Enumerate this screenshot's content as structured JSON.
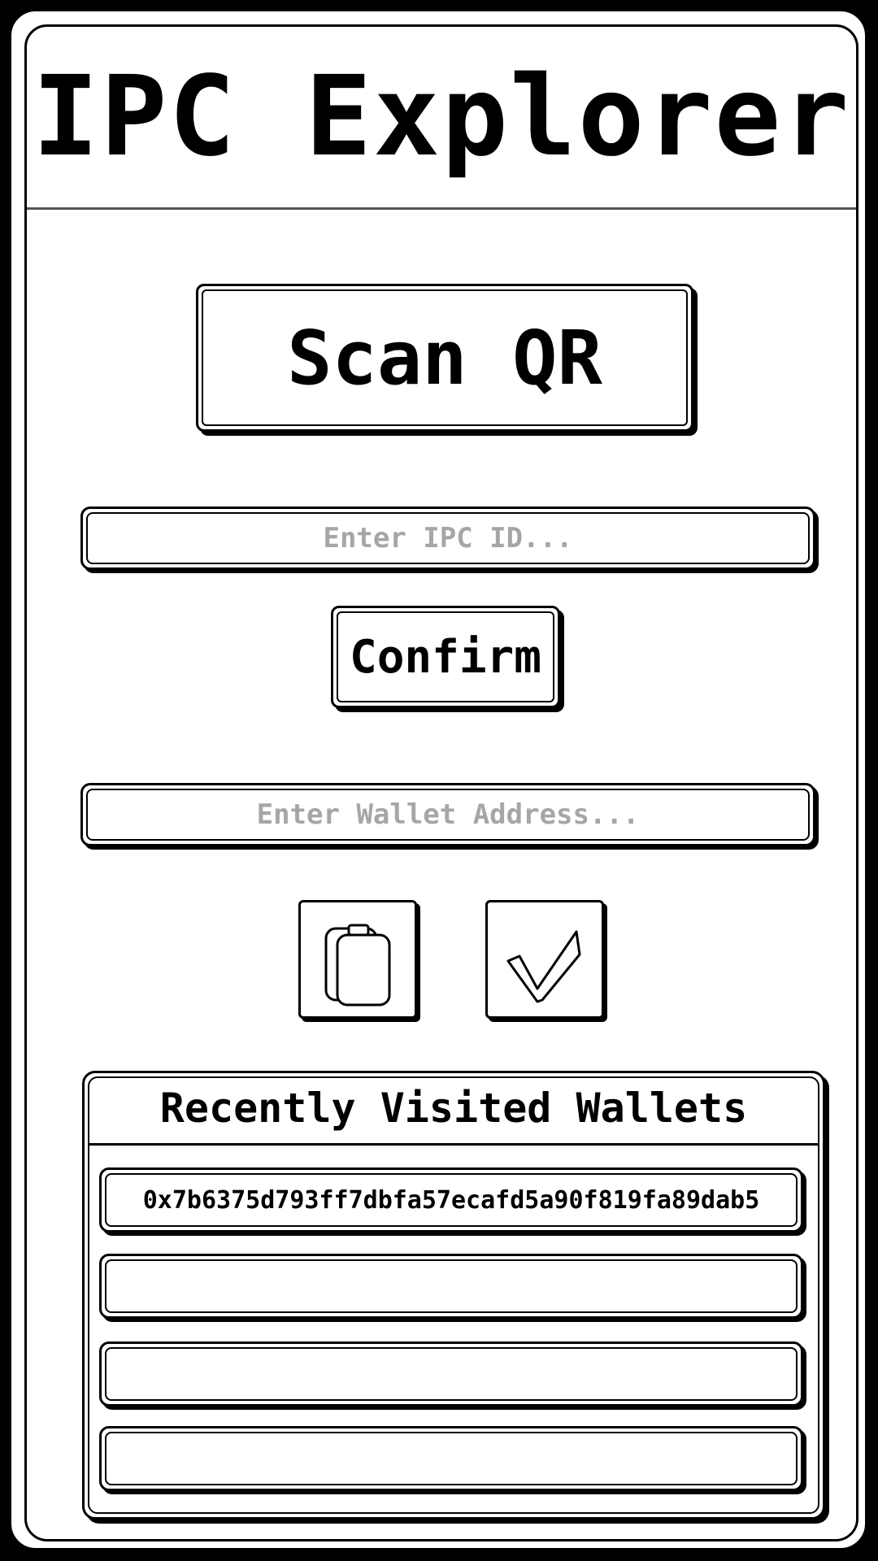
{
  "app": {
    "title": "IPC Explorer"
  },
  "actions": {
    "scan_label": "Scan QR",
    "confirm_label": "Confirm"
  },
  "inputs": {
    "ipc_id": {
      "value": "",
      "placeholder": "Enter IPC ID..."
    },
    "wallet_address": {
      "value": "",
      "placeholder": "Enter Wallet Address..."
    }
  },
  "icons": {
    "paste": "clipboard-icon",
    "submit": "checkmark-icon"
  },
  "recent": {
    "title": "Recently Visited Wallets",
    "items": [
      "0x7b6375d793ff7dbfa57ecafd5a90f819fa89dab5",
      "",
      "",
      ""
    ]
  }
}
